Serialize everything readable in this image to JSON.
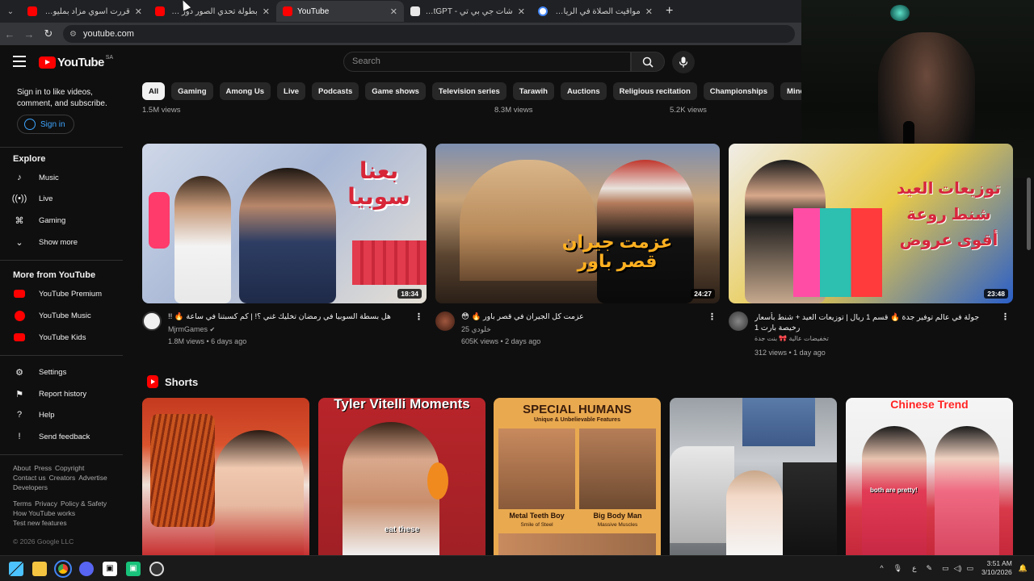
{
  "browser": {
    "tabs": [
      {
        "title": "قررت اسوي مزاد بمليون ريال 😳",
        "favicon_color": "#ff0000",
        "active": false
      },
      {
        "title": "بطولة تحدي الصور دور ال 🌙",
        "favicon_color": "#ff0000",
        "active": false
      },
      {
        "title": "YouTube",
        "favicon_color": "#ff0000",
        "active": true
      },
      {
        "title": "شات جي بي تي - ChatGPT",
        "favicon_color": "#ffffff",
        "active": false
      },
      {
        "title": "مواقيت الصلاة في الرياض - بحث",
        "favicon_color": "#4285f4",
        "active": false
      }
    ],
    "url": "youtube.com"
  },
  "header": {
    "logo_text": "YouTube",
    "country_code": "SA",
    "search_placeholder": "Search"
  },
  "sidebar": {
    "signin_prompt": "Sign in to like videos, comment, and subscribe.",
    "signin_label": "Sign in",
    "explore_title": "Explore",
    "explore_items": [
      {
        "label": "Music",
        "icon": "music-note-icon"
      },
      {
        "label": "Live",
        "icon": "live-icon"
      },
      {
        "label": "Gaming",
        "icon": "gaming-icon"
      },
      {
        "label": "Show more",
        "icon": "chevron-down-icon"
      }
    ],
    "more_title": "More from YouTube",
    "more_items": [
      {
        "label": "YouTube Premium"
      },
      {
        "label": "YouTube Music"
      },
      {
        "label": "YouTube Kids"
      }
    ],
    "settings_items": [
      {
        "label": "Settings",
        "icon": "gear-icon"
      },
      {
        "label": "Report history",
        "icon": "flag-icon"
      },
      {
        "label": "Help",
        "icon": "help-icon"
      },
      {
        "label": "Send feedback",
        "icon": "feedback-icon"
      }
    ],
    "footer_line1": [
      "About",
      "Press",
      "Copyright"
    ],
    "footer_line2": [
      "Contact us",
      "Creators",
      "Advertise"
    ],
    "footer_line3": [
      "Developers"
    ],
    "footer_line4": [
      "Terms",
      "Privacy",
      "Policy & Safety"
    ],
    "footer_line5": [
      "How YouTube works"
    ],
    "footer_line6": [
      "Test new features"
    ],
    "copyright": "© 2026 Google LLC"
  },
  "chips": [
    "All",
    "Gaming",
    "Among Us",
    "Live",
    "Podcasts",
    "Game shows",
    "Television series",
    "Tarawih",
    "Auctions",
    "Religious recitation",
    "Championships",
    "Minecraft"
  ],
  "previous_row_views": [
    "1.5M views",
    "8.3M views",
    "5.2K views"
  ],
  "videos": [
    {
      "title": "هل بسطة السوبيا في رمضان تخليك غني ؟! | كم كسبتنا في ساعة 🔥 !!",
      "channel": "MjrmGames",
      "verified": true,
      "stats": "1.8M views • 6 days ago",
      "duration": "18:34",
      "thumb_text": "بعنا سوبيا"
    },
    {
      "title": "عزمت كل الجيران في قصر باور 🔥 😳",
      "channel": "خلودي 25",
      "verified": false,
      "stats": "605K views • 2 days ago",
      "duration": "24:27",
      "thumb_text": "عزمت جيران قصر باور"
    },
    {
      "title": "جولة في عالم توفير جدة 🔥 قسم 1 ريال | توزيعات العيد + شنط بأسعار رخيصة بارت 1",
      "channel": "تخفيضات عالية 🎀 بنت جدة",
      "verified": false,
      "stats": "312 views • 1 day ago",
      "duration": "23:48",
      "thumb_text": "توزيعات العيد شنط روعة أقوى عروض"
    }
  ],
  "shorts": {
    "title": "Shorts",
    "items": [
      {
        "caption": ""
      },
      {
        "caption": "Tyler Vitelli Moments",
        "subcaption": "eat these"
      },
      {
        "caption": "SPECIAL HUMANS",
        "subcaption": "Unique & Unbelievable Features",
        "label1": "Metal Teeth Boy",
        "sub1": "Smile of Steel",
        "label2": "Big Body Man",
        "sub2": "Massive Muscles"
      },
      {
        "caption": ""
      },
      {
        "caption": "Chinese Trend",
        "subcaption": "both are pretty!"
      }
    ]
  },
  "taskbar": {
    "time": "3:51 AM",
    "date": "3/10/2026",
    "lang": "ع"
  }
}
